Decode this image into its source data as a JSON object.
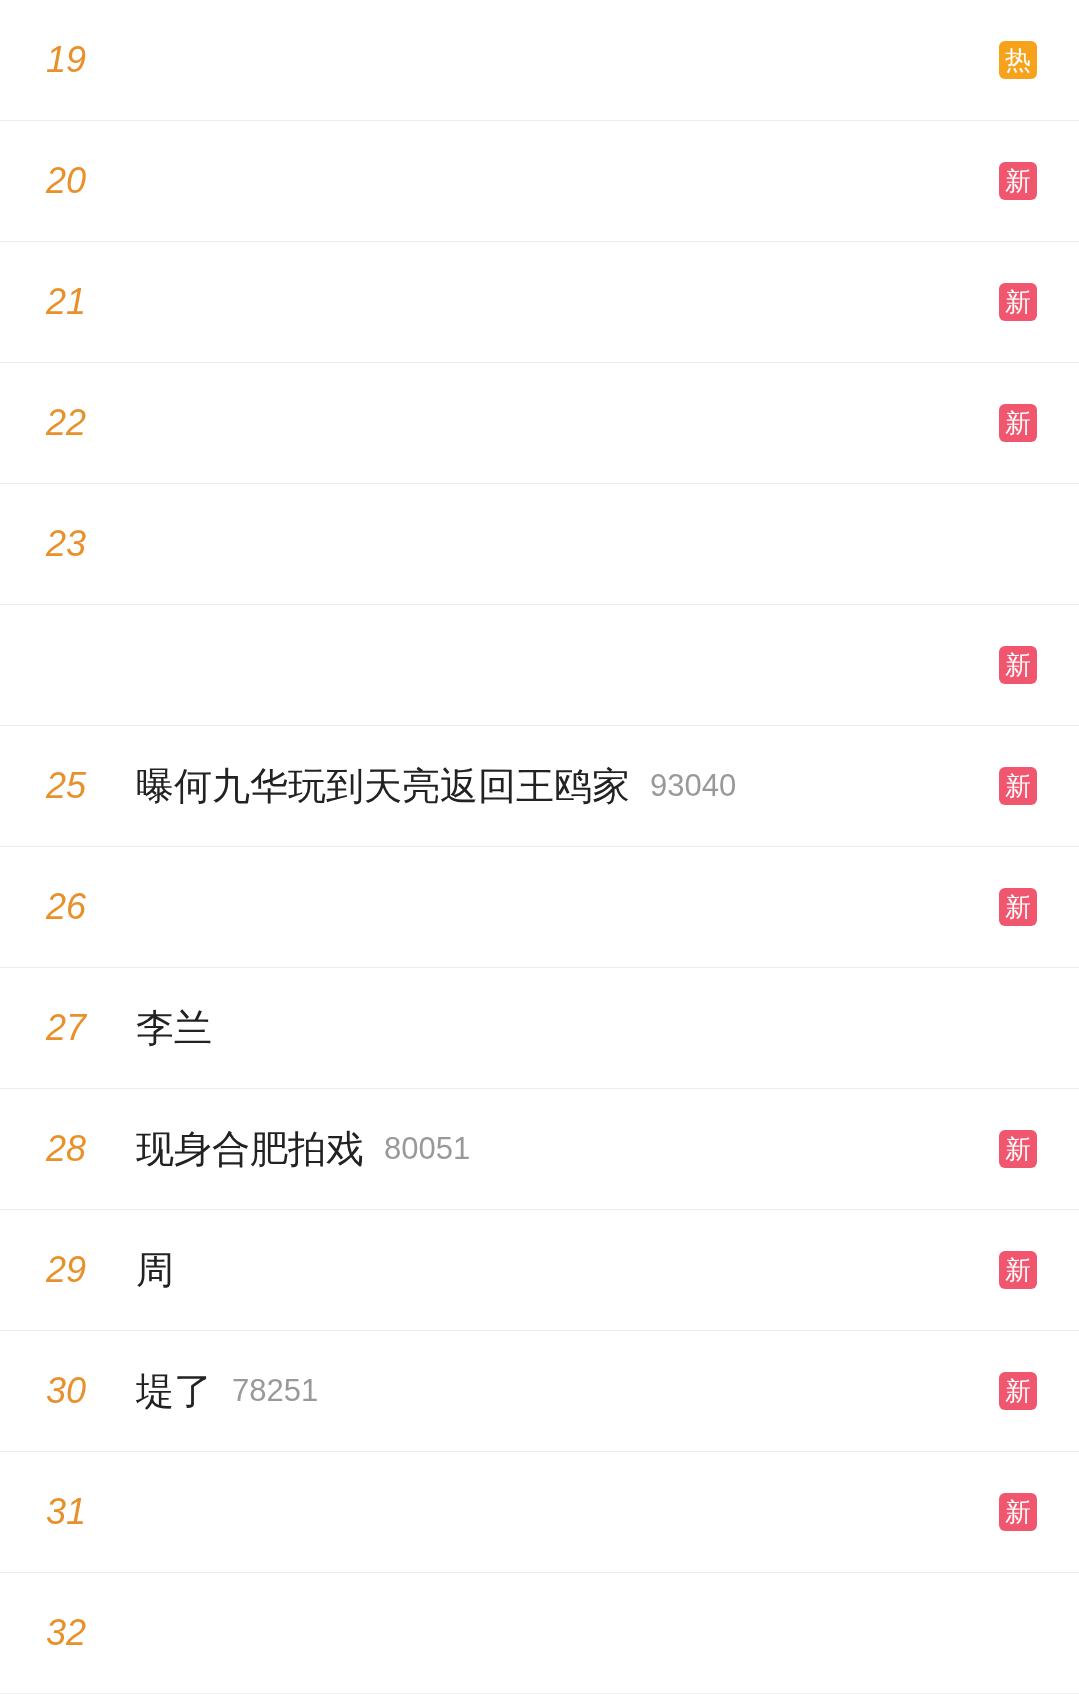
{
  "rows": [
    {
      "rank": "19",
      "badge": {
        "text": "热",
        "kind": "hot"
      }
    },
    {
      "rank": "20",
      "badge": {
        "text": "新",
        "kind": "new"
      }
    },
    {
      "rank": "21",
      "badge": {
        "text": "新",
        "kind": "new"
      }
    },
    {
      "rank": "22",
      "badge": {
        "text": "新",
        "kind": "new"
      }
    },
    {
      "rank": "23"
    },
    {
      "badge": {
        "text": "新",
        "kind": "new"
      }
    },
    {
      "rank": "25",
      "title": "曝何九华玩到天亮返回王鸥家",
      "heat": "93040",
      "badge": {
        "text": "新",
        "kind": "new"
      }
    },
    {
      "rank": "26",
      "badge": {
        "text": "新",
        "kind": "new"
      }
    },
    {
      "rank": "27",
      "title": "李兰"
    },
    {
      "rank": "28",
      "title": "现身合肥拍戏",
      "heat": "80051",
      "badge": {
        "text": "新",
        "kind": "new"
      }
    },
    {
      "rank": "29",
      "title": "周",
      "badge": {
        "text": "新",
        "kind": "new"
      }
    },
    {
      "rank": "30",
      "title": "堤了",
      "heat": "78251",
      "badge": {
        "text": "新",
        "kind": "new"
      }
    },
    {
      "rank": "31",
      "badge": {
        "text": "新",
        "kind": "new"
      }
    },
    {
      "rank": "32"
    }
  ]
}
